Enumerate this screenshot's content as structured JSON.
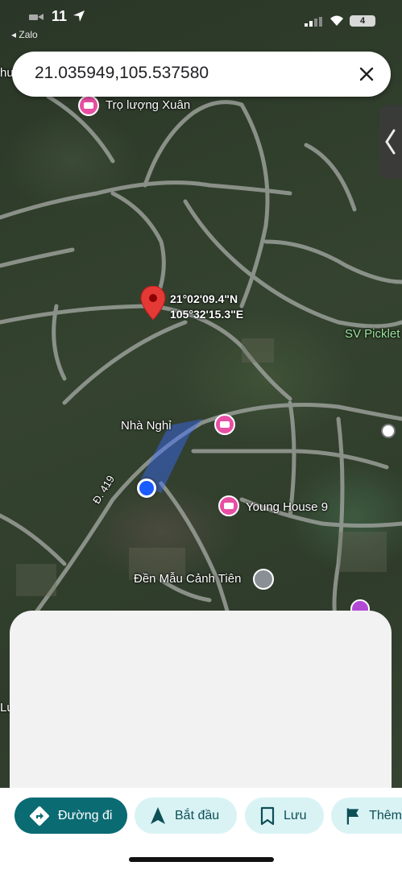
{
  "status_bar": {
    "time": "11",
    "back_app": "◂ Zalo",
    "battery": "4"
  },
  "search": {
    "query": "21.035949,105.537580"
  },
  "map": {
    "dropped_pin": {
      "lat_dms": "21°02'09.4\"N",
      "lng_dms": "105°32'15.3\"E"
    },
    "labels": {
      "tro_luong_xuan": "Trọ lượng Xuân",
      "sv_pickleball": "SV Picklet",
      "nha_nghi": "Nhà Nghỉ",
      "young_house": "Young House 9",
      "den_mau": "Đền Mẫu Cảnh Tiên",
      "road": "Đ. 419",
      "edge_lu": "Lu",
      "edge_hu": "hu"
    }
  },
  "actions": {
    "directions": "Đường đi",
    "start": "Bắt đầu",
    "save": "Lưu",
    "more": "Thêm"
  },
  "colors": {
    "primary": "#0b6b73",
    "secondary_chip": "#d9f3f5",
    "poi_pink": "#e84fa3",
    "pin_red": "#e53935",
    "location_blue": "#1a5cff"
  }
}
